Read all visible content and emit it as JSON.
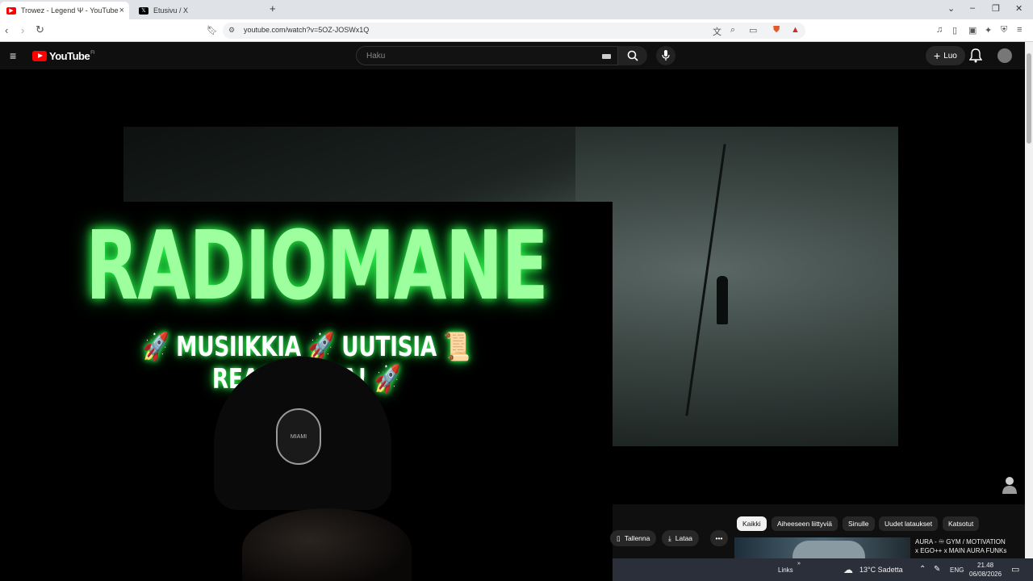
{
  "browser": {
    "tabs": [
      {
        "label": "Trowez - Legend Ψ - YouTube",
        "active": true
      },
      {
        "label": "Etusivu / X",
        "active": false
      }
    ],
    "new_tab_label": "+",
    "url": "youtube.com/watch?v=5OZ-JOSWx1Q"
  },
  "youtube": {
    "logo_text": "YouTube",
    "country_code": "FI",
    "search_placeholder": "Haku",
    "create_label": "Luo"
  },
  "overlay": {
    "title": "RADIOMANE",
    "subtitle": "🚀 MUSIIKKIA 🚀 UUTISIA 📜 REAGOINTIA! 🚀",
    "cap_badge": "MIAMI"
  },
  "filter_chips": [
    {
      "label": "Kaikki",
      "active": true
    },
    {
      "label": "Aiheeseen liittyviä",
      "active": false
    },
    {
      "label": "Sinulle",
      "active": false
    },
    {
      "label": "Uudet lataukset",
      "active": false
    },
    {
      "label": "Katsotut",
      "active": false
    }
  ],
  "actions": {
    "save_label": "Tallenna",
    "download_label": "Lataa",
    "more_label": "•••"
  },
  "recommendation": {
    "title_line1": "AURA - ♾ GYM / MOTIVATION",
    "title_line2": "x EGO++ x MAIN AURA FUNKs"
  },
  "taskbar": {
    "links_label": "Links",
    "weather": "13°C  Sadetta",
    "language": "ENG",
    "time": "21.48",
    "date": "06/08/2026"
  },
  "colors": {
    "overlay_green": "#9dff9d",
    "youtube_red": "#ff0000",
    "tabstrip": "#dfe3e8"
  }
}
